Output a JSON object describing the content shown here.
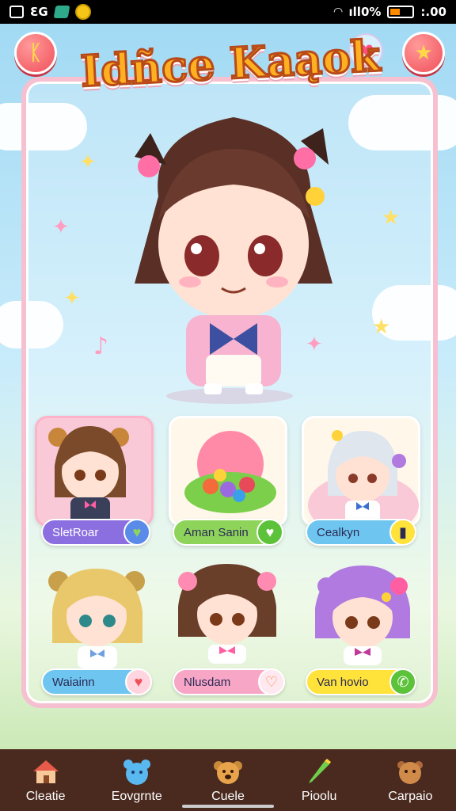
{
  "status_bar": {
    "left_text": "ƐG",
    "right_text": "ıll0%",
    "time": ":.00",
    "icons": [
      "qr-icon",
      "network-icon",
      "app-icon",
      "coin-icon",
      "wifi-icon",
      "battery-icon"
    ]
  },
  "header": {
    "title": "Idñce Kaąok",
    "left_button_icon": "back-icon",
    "right_button_icon": "star-icon",
    "heart_icon": "heart-icon"
  },
  "characters": [
    {
      "name": "SletRoar",
      "badge": "heart-icon",
      "pill_color": "#8b6fe0",
      "hair": "#7a4a2a",
      "bg": "#f9c9d7",
      "selected": true
    },
    {
      "name": "Aman Sanin",
      "badge": "heart-icon",
      "pill_color": "#8fd45a",
      "hair": "#ff6f91",
      "bg": "#fff7ea",
      "selected": false
    },
    {
      "name": "Cealkyn",
      "badge": "phone-icon",
      "pill_color": "#6ec6f0",
      "hair": "#dfe6ee",
      "bg": "#fff7ea",
      "selected": false
    },
    {
      "name": "Waiainn",
      "badge": "heart-icon",
      "pill_color": "#6ec6f0",
      "hair": "#e8c86a",
      "bg": "none",
      "selected": false
    },
    {
      "name": "Nlusdam",
      "badge": "heart-icon",
      "pill_color": "#f7a6c6",
      "hair": "#6a3f2a",
      "bg": "none",
      "selected": false
    },
    {
      "name": "Van hovio",
      "badge": "phone-icon",
      "pill_color": "#ffe23a",
      "hair": "#b07ae0",
      "bg": "none",
      "selected": false
    }
  ],
  "bottom_nav": [
    {
      "label": "Cleatie",
      "icon": "house-icon"
    },
    {
      "label": "Eovgrnte",
      "icon": "bear-icon"
    },
    {
      "label": "Cuele",
      "icon": "dog-icon"
    },
    {
      "label": "Pioolu",
      "icon": "pencil-icon"
    },
    {
      "label": "Carpaio",
      "icon": "bag-icon"
    }
  ],
  "colors": {
    "accent": "#f0505a",
    "title": "#ffb020",
    "panel_border": "#f6c0d0",
    "nav_bg": "#4a2a1f"
  }
}
